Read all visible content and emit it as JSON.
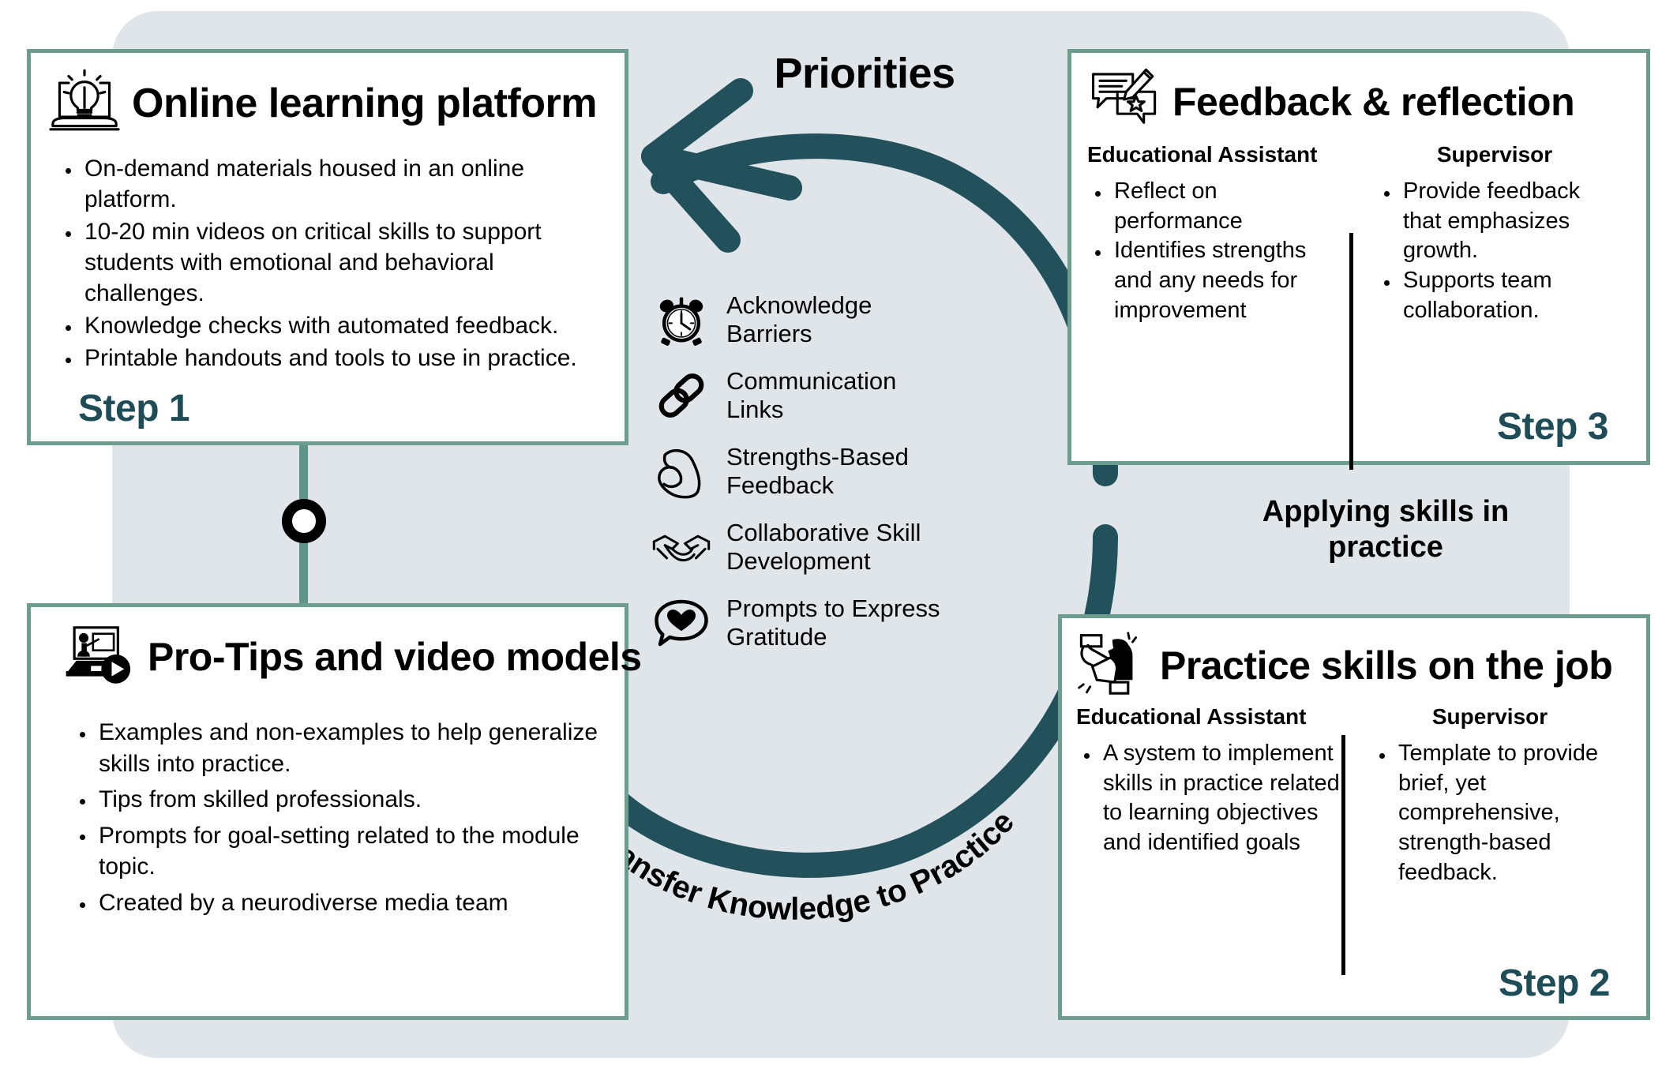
{
  "theme": {
    "backdrop": "#dfe5e9",
    "card_border": "#6d9d8f",
    "step_text": "#1e4d57",
    "arrow": "#22505b",
    "connector": "#5f9488"
  },
  "center": {
    "title": "Priorities",
    "cycle_label_right": "Applying skills in\npractice",
    "cycle_label_bottom": "Transfer Knowledge to Practice",
    "priorities": [
      {
        "icon": "alarm-clock-icon",
        "label": "Acknowledge\nBarriers"
      },
      {
        "icon": "chain-link-icon",
        "label": "Communication\nLinks"
      },
      {
        "icon": "flexed-bicep-icon",
        "label": "Strengths-Based\nFeedback"
      },
      {
        "icon": "handshake-icon",
        "label": "Collaborative Skill\nDevelopment"
      },
      {
        "icon": "heart-speech-bubble-icon",
        "label": "Prompts to Express\nGratitude"
      }
    ]
  },
  "cards": {
    "online_platform": {
      "icon": "laptop-lightbulb-icon",
      "title": "Online learning platform",
      "step": "Step 1",
      "bullets": [
        "On-demand materials housed in an online platform.",
        "10-20 min videos on critical skills to support students with emotional and behavioral challenges.",
        "Knowledge checks with automated feedback.",
        "Printable handouts and tools to use in practice."
      ]
    },
    "pro_tips": {
      "icon": "laptop-presenter-play-icon",
      "title": "Pro-Tips and video models",
      "bullets": [
        "Examples and non-examples to help generalize skills into practice.",
        "Tips from skilled professionals.",
        "Prompts for goal-setting related to the module topic.",
        "Created by a neurodiverse media team"
      ]
    },
    "feedback_reflection": {
      "icon": "feedback-bubbles-pen-icon",
      "title": "Feedback & reflection",
      "step": "Step 3",
      "col_left_head": "Educational Assistant",
      "col_left_bullets": [
        "Reflect on performance",
        "Identifies strengths and any needs for improvement"
      ],
      "col_right_head": "Supervisor",
      "col_right_bullets": [
        "Provide feedback that emphasizes growth.",
        "Supports team collaboration."
      ]
    },
    "practice_skills": {
      "icon": "hands-puzzle-pieces-icon",
      "title": "Practice skills on the job",
      "step": "Step 2",
      "col_left_head": "Educational Assistant",
      "col_left_bullets": [
        "A system to implement skills in practice related to learning objectives and identified goals"
      ],
      "col_right_head": "Supervisor",
      "col_right_bullets": [
        "Template to provide brief, yet comprehensive, strength-based feedback."
      ]
    }
  }
}
